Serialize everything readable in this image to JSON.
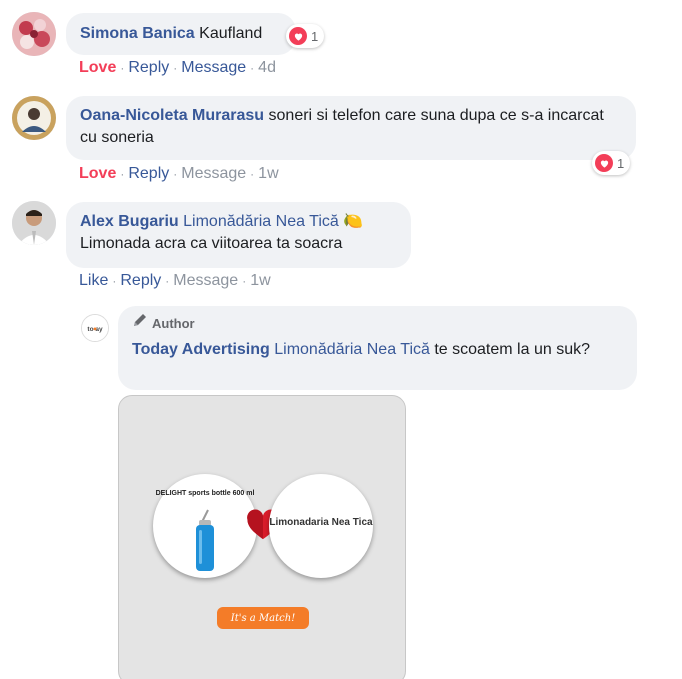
{
  "comments": [
    {
      "name": "Simona Banica",
      "text": "Kaufland",
      "reaction_count": "1",
      "actions": {
        "love": "Love",
        "reply": "Reply",
        "message": "Message",
        "time": "4d"
      }
    },
    {
      "name": "Oana-Nicoleta Murarasu",
      "text": "soneri si telefon care suna dupa ce s-a incarcat cu soneria",
      "reaction_count": "1",
      "actions": {
        "love": "Love",
        "reply": "Reply",
        "message": "Message",
        "time": "1w"
      }
    },
    {
      "name": "Alex Bugariu",
      "tagged_page": "Limonădăria Nea Tică",
      "emoji": "🍋",
      "text": "Limonada acra ca viitoarea ta soacra",
      "actions": {
        "like": "Like",
        "reply": "Reply",
        "message": "Message",
        "time": "1w"
      }
    }
  ],
  "reply": {
    "author_badge": "Author",
    "name": "Today Advertising",
    "tagged_page": "Limonădăria Nea Tică",
    "text": "te scoatem la un suk?",
    "avatar_text": "to ay",
    "image": {
      "product_label": "DELIGHT sports bottle 600 ml",
      "brand_label": "Limonadaria Nea Tica",
      "match_button": "It's a Match!"
    }
  },
  "colors": {
    "link": "#385898",
    "love": "#f33e58",
    "muted": "#8d949e",
    "bubble": "#f0f2f5",
    "match_orange": "#f47c28",
    "bottle_blue": "#1e90d8"
  }
}
